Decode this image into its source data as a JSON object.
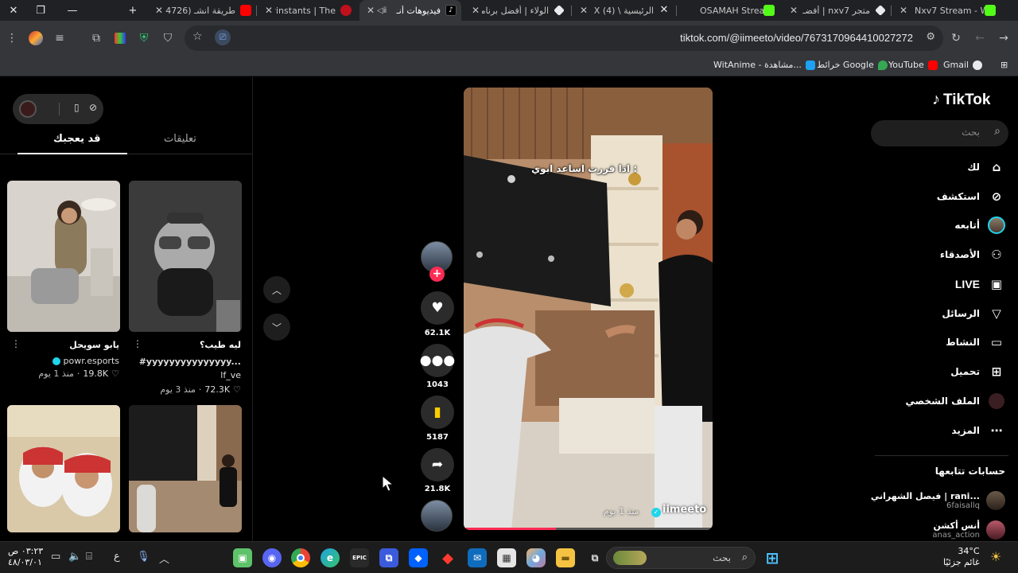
{
  "browser": {
    "tabs": [
      {
        "title": "طريقة انشـ (4726)",
        "icon_color": "#ff0000",
        "active": false
      },
      {
        "title": "Myinstants | The",
        "icon_color": "#c0101e",
        "active": false
      },
      {
        "title": "فيديوهات أنـ",
        "icon_color": "#000000",
        "active": true
      },
      {
        "title": "الولاء | أفضل برنامـ",
        "icon_color": "#e8eaed",
        "active": false
      },
      {
        "title": "الرئيسية \\ X (4)",
        "icon_color": "#000000",
        "active": false
      },
      {
        "title": "OSAMAH Stream",
        "icon_color": "#53fc18",
        "active": false
      },
      {
        "title": "متجر nxv7 | أفضـ",
        "icon_color": "#e8eaed",
        "active": false
      },
      {
        "title": "Nxv7 Stream - W",
        "icon_color": "#53fc18",
        "active": false
      }
    ],
    "url": "tiktok.com/@iimeeto/video/7673170964410027272",
    "bookmarks": [
      {
        "label": "Gmail",
        "icon_color": "#e8eaed"
      },
      {
        "label": "YouTube",
        "icon_color": "#ff0000"
      },
      {
        "label": "خرائط Google",
        "icon_color": "#34a853"
      },
      {
        "label": "WitAnime - مشاهدة...",
        "icon_color": "#1da1f2"
      }
    ]
  },
  "tiktok": {
    "logo": "TikTok",
    "search_placeholder": "بحث",
    "nav": [
      {
        "label": "لك",
        "icon": "home-icon"
      },
      {
        "label": "استكشف",
        "icon": "compass-icon"
      },
      {
        "label": "أتابعه",
        "icon": "following-avatar-icon"
      },
      {
        "label": "الأصدقاء",
        "icon": "friends-icon"
      },
      {
        "label": "LIVE",
        "icon": "live-icon"
      },
      {
        "label": "الرسائل",
        "icon": "messages-icon"
      },
      {
        "label": "النشاط",
        "icon": "activity-icon"
      },
      {
        "label": "تحميل",
        "icon": "upload-icon"
      },
      {
        "label": "الملف الشخصي",
        "icon": "profile-icon"
      },
      {
        "label": "المزيد",
        "icon": "more-icon"
      }
    ],
    "following_title": "حسابات تتابعها",
    "following_accounts": [
      {
        "name": "فيصل الشهراني | rani...",
        "handle": "6faisallq"
      },
      {
        "name": "أنس أكشن",
        "handle": "anas_action"
      }
    ],
    "video": {
      "caption": "اذا قررت اساعد ابوي :",
      "author": "iimeeto",
      "time": "منذ 1 يوم",
      "progress": 0.37
    },
    "actions": {
      "likes": "62.1K",
      "comments": "1043",
      "saves": "5187",
      "shares": "21.8K"
    },
    "panel_tabs": {
      "active": "قد يعجبك",
      "other": "تعليقات"
    },
    "recommendations": [
      {
        "title": "ليه طيب؟",
        "subtitle": "#yyyyyyyyyyyyyyy...",
        "author": "lf_ve",
        "likes": "72.3K",
        "time": "منذ 3 يوم",
        "verified": false
      },
      {
        "title": "يابو سويحل",
        "subtitle": "",
        "author": "powr.esports",
        "likes": "19.8K",
        "time": "منذ 1 يوم",
        "verified": true
      }
    ]
  },
  "taskbar": {
    "search_label": "بحث",
    "weather_temp": "34°C",
    "weather_desc": "غائم جزئيًا",
    "time": "٠٣:٢٣ ص",
    "date": "٤٨/٠٣/٠١",
    "lang": "ع"
  }
}
